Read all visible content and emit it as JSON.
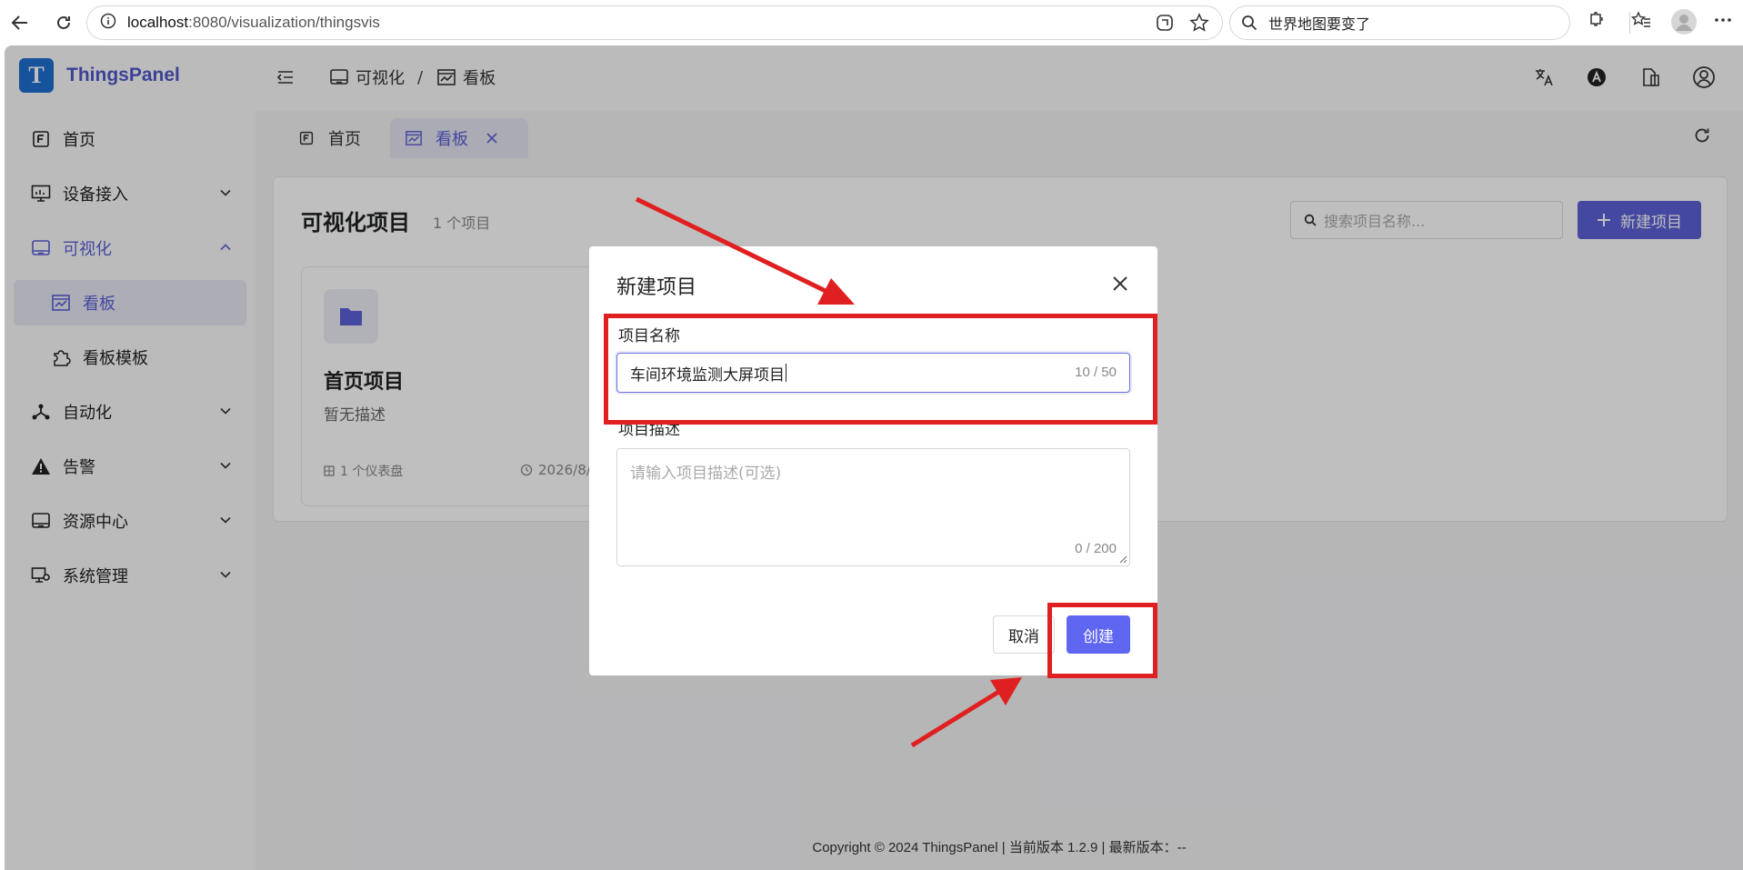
{
  "browser": {
    "url_host": "localhost",
    "url_rest": ":8080/visualization/thingsvis",
    "search_text": "世界地图要变了"
  },
  "brand": {
    "logo_letter": "T",
    "name": "ThingsPanel"
  },
  "sidebar": {
    "items": [
      {
        "label": "首页"
      },
      {
        "label": "设备接入"
      },
      {
        "label": "可视化"
      },
      {
        "label": "看板"
      },
      {
        "label": "看板模板"
      },
      {
        "label": "自动化"
      },
      {
        "label": "告警"
      },
      {
        "label": "资源中心"
      },
      {
        "label": "系统管理"
      }
    ]
  },
  "header": {
    "breadcrumb": [
      {
        "label": "可视化"
      },
      {
        "label": "看板"
      }
    ],
    "separator": "/"
  },
  "tabs": [
    {
      "label": "首页"
    },
    {
      "label": "看板"
    }
  ],
  "main": {
    "title": "可视化项目",
    "count": "1 个项目",
    "search_placeholder": "搜索项目名称...",
    "new_button": "新建项目",
    "card": {
      "title": "首页项目",
      "description": "暂无描述",
      "dashboards": "1 个仪表盘",
      "date": "2026/8/"
    }
  },
  "footer": {
    "text": "Copyright © 2024 ThingsPanel  |  当前版本 1.2.9  |  最新版本：--"
  },
  "modal": {
    "title": "新建项目",
    "name_label": "项目名称",
    "name_value": "车间环境监测大屏项目",
    "name_count": "10 / 50",
    "desc_label": "项目描述",
    "desc_placeholder": "请输入项目描述(可选)",
    "desc_count": "0 / 200",
    "cancel": "取消",
    "create": "创建"
  },
  "colors": {
    "accent": "#5b61d6",
    "primary_button": "#5f66f2",
    "annotation_red": "#e02020"
  }
}
